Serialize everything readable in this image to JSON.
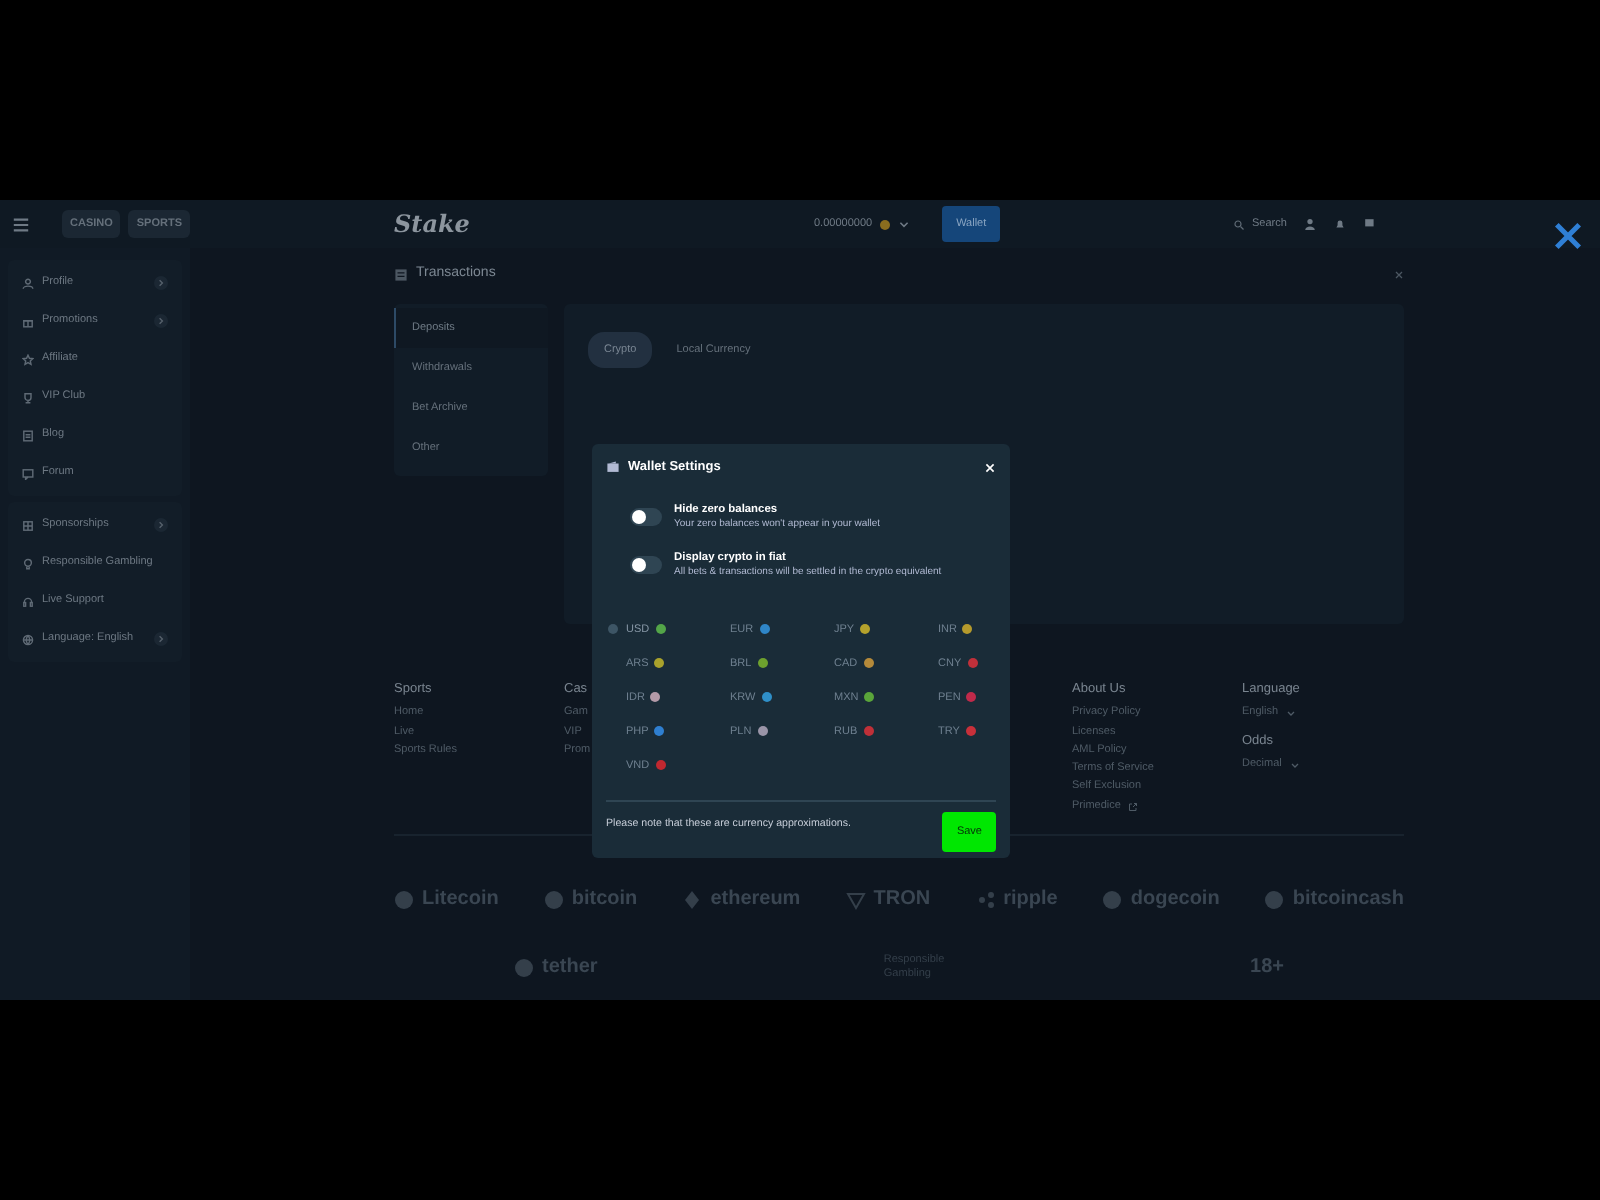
{
  "header": {
    "nav_buttons": [
      "CASINO",
      "SPORTS"
    ],
    "logo": "Stake",
    "balance": "0.00000000",
    "wallet_button": "Wallet",
    "search": "Search"
  },
  "sidebar": {
    "groups": [
      [
        {
          "label": "Profile",
          "expandable": true
        },
        {
          "label": "Promotions",
          "expandable": true
        },
        {
          "label": "Affiliate",
          "expandable": false
        },
        {
          "label": "VIP Club",
          "expandable": false
        },
        {
          "label": "Blog",
          "expandable": false
        },
        {
          "label": "Forum",
          "expandable": false
        }
      ],
      [
        {
          "label": "Sponsorships",
          "expandable": true
        },
        {
          "label": "Responsible Gambling",
          "expandable": false
        },
        {
          "label": "Live Support",
          "expandable": false
        },
        {
          "label": "Language: English",
          "expandable": true
        }
      ]
    ]
  },
  "transactions": {
    "title": "Transactions",
    "menu": [
      {
        "label": "Deposits",
        "selected": true
      },
      {
        "label": "Withdrawals",
        "selected": false
      },
      {
        "label": "Bet Archive",
        "selected": false
      },
      {
        "label": "Other",
        "selected": false
      }
    ],
    "tabs": [
      {
        "label": "Crypto",
        "selected": true
      },
      {
        "label": "Local Currency",
        "selected": false
      }
    ]
  },
  "footer": {
    "columns": [
      {
        "heading": "Sports",
        "links": [
          {
            "label": "Home",
            "external": false
          },
          {
            "label": "Live",
            "external": false
          },
          {
            "label": "Sports Rules",
            "external": false
          }
        ]
      },
      {
        "heading": "Cas",
        "links": [
          {
            "label": "Gam",
            "external": false
          },
          {
            "label": "VIP",
            "external": false
          },
          {
            "label": "Prom",
            "external": false
          }
        ]
      },
      {
        "heading": "About Us",
        "links": [
          {
            "label": "Privacy Policy",
            "external": false
          },
          {
            "label": "Licenses",
            "external": false
          },
          {
            "label": "AML Policy",
            "external": false
          },
          {
            "label": "Terms of Service",
            "external": false
          },
          {
            "label": "Self Exclusion",
            "external": false
          },
          {
            "label": "Primedice",
            "external": true
          }
        ]
      }
    ],
    "settings": [
      {
        "heading": "Language",
        "value": "English"
      },
      {
        "heading": "Odds",
        "value": "Decimal"
      }
    ],
    "logos": [
      [
        "Litecoin",
        "bitcoin",
        "ethereum",
        "TRON",
        "ripple",
        "dogecoin",
        "bitcoincash"
      ],
      [
        "tether",
        "Responsible Gambling",
        "18+"
      ]
    ]
  },
  "modal": {
    "title": "Wallet Settings",
    "toggles": [
      {
        "label": "Hide zero balances",
        "description": "Your zero balances won't appear in your wallet",
        "on": false
      },
      {
        "label": "Display crypto in fiat",
        "description": "All bets & transactions will be settled in the crypto equivalent",
        "on": false
      }
    ],
    "currencies": [
      {
        "code": "USD",
        "color": "#53a548",
        "selected": true
      },
      {
        "code": "EUR",
        "color": "#2f86c8",
        "selected": false
      },
      {
        "code": "JPY",
        "color": "#b5a22c",
        "selected": false
      },
      {
        "code": "INR",
        "color": "#b59a2c",
        "selected": false
      },
      {
        "code": "ARS",
        "color": "#a9a22c",
        "selected": false
      },
      {
        "code": "BRL",
        "color": "#6ea12e",
        "selected": false
      },
      {
        "code": "CAD",
        "color": "#b58a3a",
        "selected": false
      },
      {
        "code": "CNY",
        "color": "#c0303a",
        "selected": false
      },
      {
        "code": "IDR",
        "color": "#b39aa8",
        "selected": false
      },
      {
        "code": "KRW",
        "color": "#2f8fc8",
        "selected": false
      },
      {
        "code": "MXN",
        "color": "#5aa53a",
        "selected": false
      },
      {
        "code": "PEN",
        "color": "#c02a4a",
        "selected": false
      },
      {
        "code": "PHP",
        "color": "#2f7fd0",
        "selected": false
      },
      {
        "code": "PLN",
        "color": "#9a95a8",
        "selected": false
      },
      {
        "code": "RUB",
        "color": "#c03038",
        "selected": false
      },
      {
        "code": "TRY",
        "color": "#c8303a",
        "selected": false
      },
      {
        "code": "VND",
        "color": "#c02830",
        "selected": false
      }
    ],
    "note": "Please note that these are currency approximations.",
    "save_button": "Save"
  }
}
